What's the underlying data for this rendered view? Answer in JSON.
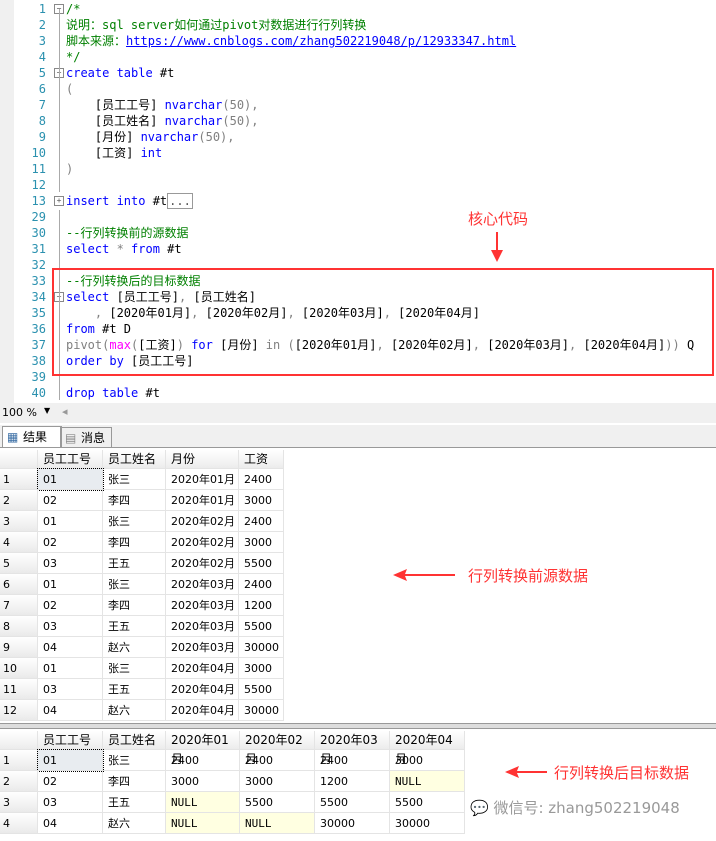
{
  "editor": {
    "lines": [
      {
        "n": "1",
        "t": [
          [
            "/*",
            "cm"
          ]
        ]
      },
      {
        "n": "2",
        "t": [
          [
            "说明：sql server如何通过pivot对数据进行行列转换",
            "cm"
          ]
        ]
      },
      {
        "n": "3",
        "t": [
          [
            "脚本来源：",
            "cm"
          ],
          [
            "https://www.cnblogs.com/zhang502219048/p/12933347.html",
            "url"
          ]
        ]
      },
      {
        "n": "4",
        "t": [
          [
            "*/",
            "cm"
          ]
        ]
      },
      {
        "n": "5",
        "t": [
          [
            "create table ",
            "kw"
          ],
          [
            "#t",
            ""
          ]
        ]
      },
      {
        "n": "6",
        "t": [
          [
            "(",
            "gr"
          ]
        ]
      },
      {
        "n": "7",
        "t": [
          [
            "    [员工工号] ",
            ""
          ],
          [
            "nvarchar",
            "kw"
          ],
          [
            "(50),",
            "gr"
          ]
        ]
      },
      {
        "n": "8",
        "t": [
          [
            "    [员工姓名] ",
            ""
          ],
          [
            "nvarchar",
            "kw"
          ],
          [
            "(50),",
            "gr"
          ]
        ]
      },
      {
        "n": "9",
        "t": [
          [
            "    [月份] ",
            ""
          ],
          [
            "nvarchar",
            "kw"
          ],
          [
            "(50),",
            "gr"
          ]
        ]
      },
      {
        "n": "10",
        "t": [
          [
            "    [工资] ",
            ""
          ],
          [
            "int",
            "kw"
          ]
        ]
      },
      {
        "n": "11",
        "t": [
          [
            ")",
            "gr"
          ]
        ]
      },
      {
        "n": "12",
        "t": []
      },
      {
        "n": "13",
        "t": [
          [
            "insert into ",
            "kw"
          ],
          [
            "#t",
            ""
          ],
          [
            "...",
            "collapsed"
          ]
        ]
      },
      {
        "n": "29",
        "t": []
      },
      {
        "n": "30",
        "t": [
          [
            "--行列转换前的源数据",
            "cm"
          ]
        ]
      },
      {
        "n": "31",
        "t": [
          [
            "select ",
            "kw"
          ],
          [
            "* ",
            "gr"
          ],
          [
            "from ",
            "kw"
          ],
          [
            "#t",
            ""
          ]
        ]
      },
      {
        "n": "32",
        "t": []
      },
      {
        "n": "33",
        "t": [
          [
            "--行列转换后的目标数据",
            "cm"
          ]
        ]
      },
      {
        "n": "34",
        "t": [
          [
            "select ",
            "kw"
          ],
          [
            "[员工工号]",
            ""
          ],
          [
            ", ",
            "gr"
          ],
          [
            "[员工姓名]",
            ""
          ]
        ]
      },
      {
        "n": "35",
        "t": [
          [
            "    , ",
            "gr"
          ],
          [
            "[2020年01月]",
            ""
          ],
          [
            ", ",
            "gr"
          ],
          [
            "[2020年02月]",
            ""
          ],
          [
            ", ",
            "gr"
          ],
          [
            "[2020年03月]",
            ""
          ],
          [
            ", ",
            "gr"
          ],
          [
            "[2020年04月]",
            ""
          ]
        ]
      },
      {
        "n": "36",
        "t": [
          [
            "from ",
            "kw"
          ],
          [
            "#t D",
            ""
          ]
        ]
      },
      {
        "n": "37",
        "t": [
          [
            "pivot(",
            "gr"
          ],
          [
            "max",
            "fn"
          ],
          [
            "(",
            "gr"
          ],
          [
            "[工资]",
            ""
          ],
          [
            ") ",
            "gr"
          ],
          [
            "for ",
            "kw"
          ],
          [
            "[月份] ",
            ""
          ],
          [
            "in (",
            "gr"
          ],
          [
            "[2020年01月]",
            ""
          ],
          [
            ", ",
            "gr"
          ],
          [
            "[2020年02月]",
            ""
          ],
          [
            ", ",
            "gr"
          ],
          [
            "[2020年03月]",
            ""
          ],
          [
            ", ",
            "gr"
          ],
          [
            "[2020年04月]",
            ""
          ],
          [
            ")) ",
            "gr"
          ],
          [
            "Q",
            ""
          ]
        ]
      },
      {
        "n": "38",
        "t": [
          [
            "order by ",
            "kw"
          ],
          [
            "[员工工号]",
            ""
          ]
        ]
      },
      {
        "n": "39",
        "t": []
      },
      {
        "n": "40",
        "t": [
          [
            "drop table ",
            "kw"
          ],
          [
            "#t",
            ""
          ]
        ]
      }
    ]
  },
  "zoom": "100 %",
  "tabs": [
    "结果",
    "消息"
  ],
  "grid1": {
    "headers": [
      "员工工号",
      "员工姓名",
      "月份",
      "工资"
    ],
    "rows": [
      [
        "1",
        "01",
        "张三",
        "2020年01月",
        "2400"
      ],
      [
        "2",
        "02",
        "李四",
        "2020年01月",
        "3000"
      ],
      [
        "3",
        "01",
        "张三",
        "2020年02月",
        "2400"
      ],
      [
        "4",
        "02",
        "李四",
        "2020年02月",
        "3000"
      ],
      [
        "5",
        "03",
        "王五",
        "2020年02月",
        "5500"
      ],
      [
        "6",
        "01",
        "张三",
        "2020年03月",
        "2400"
      ],
      [
        "7",
        "02",
        "李四",
        "2020年03月",
        "1200"
      ],
      [
        "8",
        "03",
        "王五",
        "2020年03月",
        "5500"
      ],
      [
        "9",
        "04",
        "赵六",
        "2020年03月",
        "30000"
      ],
      [
        "10",
        "01",
        "张三",
        "2020年04月",
        "3000"
      ],
      [
        "11",
        "03",
        "王五",
        "2020年04月",
        "5500"
      ],
      [
        "12",
        "04",
        "赵六",
        "2020年04月",
        "30000"
      ]
    ]
  },
  "grid2": {
    "headers": [
      "员工工号",
      "员工姓名",
      "2020年01月",
      "2020年02月",
      "2020年03月",
      "2020年04月"
    ],
    "rows": [
      [
        "1",
        "01",
        "张三",
        "2400",
        "2400",
        "2400",
        "3000"
      ],
      [
        "2",
        "02",
        "李四",
        "3000",
        "3000",
        "1200",
        "NULL"
      ],
      [
        "3",
        "03",
        "王五",
        "NULL",
        "5500",
        "5500",
        "5500"
      ],
      [
        "4",
        "04",
        "赵六",
        "NULL",
        "NULL",
        "30000",
        "30000"
      ]
    ]
  },
  "annotations": {
    "core": "核心代码",
    "source": "行列转换前源数据",
    "target": "行列转换后目标数据",
    "watermark": "微信号: zhang502219048"
  },
  "colors": {
    "red": "#ff3333",
    "keyword": "#0000ff",
    "comment": "#008000",
    "null_bg": "#ffffe1"
  }
}
